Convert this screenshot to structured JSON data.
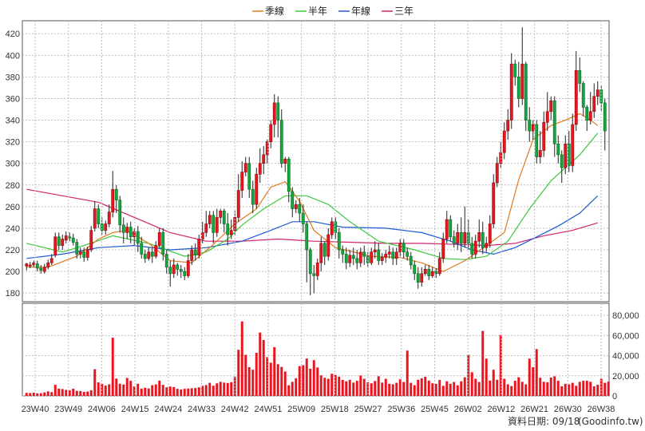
{
  "chart_data": {
    "type": "candlestick",
    "legend": [
      {
        "label": "季線",
        "color": "#e07a1c"
      },
      {
        "label": "半年",
        "color": "#3cc83c"
      },
      {
        "label": "年線",
        "color": "#1e5ad2"
      },
      {
        "label": "三年",
        "color": "#d2236e"
      }
    ],
    "x_ticks": [
      "23W40",
      "23W49",
      "24W06",
      "24W15",
      "24W24",
      "24W33",
      "24W42",
      "24W51",
      "25W09",
      "25W18",
      "25W27",
      "25W36",
      "25W45",
      "26W02",
      "26W12",
      "26W21",
      "26W30",
      "26W38"
    ],
    "price_ticks": [
      "180",
      "200",
      "220",
      "240",
      "260",
      "280",
      "300",
      "320",
      "340",
      "360",
      "380",
      "400",
      "420"
    ],
    "price_range": [
      172,
      432
    ],
    "volume_ticks": [
      "0",
      "20,000",
      "40,000",
      "60,000",
      "80,000"
    ],
    "volume_range": [
      0,
      92000
    ],
    "candles": [
      [
        205,
        207,
        201,
        208
      ],
      [
        205,
        206,
        203,
        209
      ],
      [
        206,
        208,
        204,
        210
      ],
      [
        207,
        203,
        200,
        210
      ],
      [
        203,
        201,
        198,
        206
      ],
      [
        200,
        204,
        198,
        207
      ],
      [
        204,
        208,
        202,
        211
      ],
      [
        208,
        212,
        206,
        216
      ],
      [
        215,
        232,
        213,
        236
      ],
      [
        232,
        224,
        220,
        236
      ],
      [
        224,
        230,
        220,
        234
      ],
      [
        229,
        233,
        226,
        237
      ],
      [
        232,
        231,
        228,
        236
      ],
      [
        231,
        227,
        224,
        235
      ],
      [
        227,
        216,
        212,
        230
      ],
      [
        216,
        218,
        212,
        222
      ],
      [
        218,
        213,
        209,
        222
      ],
      [
        213,
        220,
        210,
        223
      ],
      [
        220,
        238,
        218,
        242
      ],
      [
        240,
        258,
        237,
        265
      ],
      [
        258,
        244,
        240,
        262
      ],
      [
        244,
        238,
        234,
        250
      ],
      [
        238,
        244,
        234,
        247
      ],
      [
        244,
        255,
        241,
        262
      ],
      [
        255,
        276,
        250,
        293
      ],
      [
        276,
        266,
        254,
        280
      ],
      [
        266,
        243,
        236,
        270
      ],
      [
        243,
        236,
        226,
        250
      ],
      [
        236,
        241,
        230,
        245
      ],
      [
        241,
        232,
        226,
        246
      ],
      [
        232,
        237,
        224,
        240
      ],
      [
        237,
        226,
        218,
        242
      ],
      [
        226,
        216,
        212,
        232
      ],
      [
        216,
        212,
        208,
        220
      ],
      [
        212,
        218,
        210,
        222
      ],
      [
        218,
        214,
        208,
        222
      ],
      [
        214,
        224,
        212,
        228
      ],
      [
        224,
        236,
        222,
        240
      ],
      [
        236,
        216,
        210,
        240
      ],
      [
        216,
        204,
        198,
        220
      ],
      [
        204,
        198,
        186,
        210
      ],
      [
        198,
        206,
        194,
        212
      ],
      [
        206,
        202,
        196,
        208
      ],
      [
        202,
        200,
        194,
        206
      ],
      [
        200,
        196,
        192,
        204
      ],
      [
        196,
        210,
        194,
        216
      ],
      [
        210,
        220,
        206,
        224
      ],
      [
        220,
        215,
        210,
        226
      ],
      [
        215,
        230,
        212,
        234
      ],
      [
        230,
        236,
        226,
        246
      ],
      [
        236,
        244,
        232,
        256
      ],
      [
        244,
        252,
        240,
        256
      ],
      [
        252,
        236,
        226,
        256
      ],
      [
        236,
        250,
        232,
        258
      ],
      [
        250,
        256,
        244,
        258
      ],
      [
        256,
        244,
        236,
        258
      ],
      [
        244,
        234,
        224,
        254
      ],
      [
        234,
        238,
        230,
        248
      ],
      [
        238,
        250,
        234,
        256
      ],
      [
        250,
        275,
        246,
        290
      ],
      [
        275,
        292,
        268,
        302
      ],
      [
        292,
        300,
        288,
        306
      ],
      [
        300,
        276,
        268,
        306
      ],
      [
        276,
        262,
        254,
        284
      ],
      [
        262,
        290,
        258,
        296
      ],
      [
        290,
        300,
        282,
        314
      ],
      [
        300,
        308,
        290,
        316
      ],
      [
        308,
        320,
        300,
        322
      ],
      [
        320,
        336,
        314,
        340
      ],
      [
        336,
        356,
        324,
        364
      ],
      [
        356,
        340,
        324,
        362
      ],
      [
        340,
        300,
        296,
        350
      ],
      [
        300,
        304,
        292,
        306
      ],
      [
        304,
        274,
        264,
        306
      ],
      [
        274,
        258,
        250,
        278
      ],
      [
        258,
        262,
        254,
        266
      ],
      [
        262,
        254,
        246,
        268
      ],
      [
        254,
        244,
        236,
        262
      ],
      [
        244,
        220,
        190,
        246
      ],
      [
        220,
        198,
        178,
        222
      ],
      [
        198,
        196,
        180,
        206
      ],
      [
        196,
        208,
        192,
        212
      ],
      [
        208,
        226,
        200,
        232
      ],
      [
        226,
        214,
        206,
        228
      ],
      [
        214,
        234,
        210,
        240
      ],
      [
        234,
        246,
        230,
        250
      ],
      [
        246,
        236,
        230,
        250
      ],
      [
        236,
        220,
        212,
        240
      ],
      [
        220,
        216,
        208,
        224
      ],
      [
        216,
        208,
        202,
        222
      ],
      [
        208,
        215,
        204,
        220
      ],
      [
        215,
        212,
        206,
        222
      ],
      [
        212,
        208,
        202,
        220
      ],
      [
        208,
        218,
        204,
        222
      ],
      [
        218,
        214,
        206,
        224
      ],
      [
        214,
        208,
        204,
        218
      ],
      [
        208,
        218,
        206,
        222
      ],
      [
        218,
        220,
        212,
        228
      ],
      [
        220,
        210,
        206,
        226
      ],
      [
        210,
        213,
        206,
        217
      ],
      [
        213,
        216,
        208,
        220
      ],
      [
        216,
        218,
        212,
        224
      ],
      [
        218,
        212,
        206,
        222
      ],
      [
        212,
        218,
        206,
        222
      ],
      [
        218,
        226,
        214,
        230
      ],
      [
        226,
        218,
        212,
        230
      ],
      [
        218,
        214,
        210,
        222
      ],
      [
        214,
        206,
        202,
        218
      ],
      [
        206,
        198,
        192,
        210
      ],
      [
        198,
        190,
        184,
        204
      ],
      [
        190,
        198,
        186,
        204
      ],
      [
        198,
        202,
        196,
        206
      ],
      [
        202,
        196,
        192,
        206
      ],
      [
        196,
        200,
        194,
        204
      ],
      [
        200,
        198,
        194,
        203
      ],
      [
        198,
        212,
        196,
        218
      ],
      [
        212,
        230,
        208,
        236
      ],
      [
        230,
        248,
        226,
        256
      ],
      [
        248,
        232,
        228,
        252
      ],
      [
        232,
        226,
        222,
        238
      ],
      [
        226,
        236,
        220,
        244
      ],
      [
        236,
        226,
        218,
        250
      ],
      [
        226,
        236,
        222,
        260
      ],
      [
        236,
        226,
        220,
        248
      ],
      [
        226,
        216,
        212,
        232
      ],
      [
        216,
        228,
        212,
        234
      ],
      [
        228,
        236,
        222,
        248
      ],
      [
        236,
        222,
        216,
        246
      ],
      [
        222,
        226,
        218,
        232
      ],
      [
        226,
        244,
        222,
        252
      ],
      [
        244,
        282,
        240,
        290
      ],
      [
        282,
        300,
        278,
        306
      ],
      [
        300,
        310,
        296,
        320
      ],
      [
        310,
        330,
        304,
        338
      ],
      [
        330,
        340,
        322,
        350
      ],
      [
        340,
        392,
        332,
        402
      ],
      [
        392,
        380,
        372,
        396
      ],
      [
        380,
        360,
        352,
        394
      ],
      [
        360,
        392,
        354,
        426
      ],
      [
        392,
        340,
        330,
        394
      ],
      [
        340,
        330,
        320,
        352
      ],
      [
        330,
        336,
        322,
        340
      ],
      [
        336,
        306,
        300,
        340
      ],
      [
        306,
        312,
        300,
        330
      ],
      [
        312,
        338,
        306,
        348
      ],
      [
        338,
        348,
        330,
        366
      ],
      [
        348,
        358,
        340,
        362
      ],
      [
        358,
        318,
        306,
        362
      ],
      [
        318,
        308,
        300,
        326
      ],
      [
        308,
        296,
        282,
        312
      ],
      [
        296,
        318,
        290,
        326
      ],
      [
        318,
        298,
        292,
        330
      ],
      [
        298,
        336,
        292,
        346
      ],
      [
        336,
        386,
        330,
        404
      ],
      [
        386,
        374,
        366,
        398
      ],
      [
        374,
        352,
        344,
        376
      ],
      [
        352,
        340,
        330,
        354
      ],
      [
        340,
        348,
        336,
        366
      ],
      [
        348,
        362,
        342,
        374
      ],
      [
        362,
        368,
        354,
        376
      ],
      [
        368,
        356,
        348,
        372
      ],
      [
        356,
        330,
        312,
        360
      ]
    ],
    "volumes": [
      3000,
      2800,
      3200,
      2500,
      2600,
      3500,
      4500,
      3800,
      11000,
      7200,
      6800,
      6000,
      5500,
      7100,
      5000,
      4800,
      3900,
      4300,
      5600,
      26500,
      13400,
      12000,
      10200,
      11500,
      57800,
      17200,
      12100,
      11300,
      17800,
      15000,
      9500,
      12000,
      7200,
      8100,
      7400,
      10600,
      11400,
      15200,
      11000,
      8500,
      9300,
      8800,
      7000,
      6400,
      7000,
      7300,
      7600,
      7900,
      8500,
      10000,
      10800,
      13000,
      10100,
      12500,
      14000,
      13200,
      12800,
      13600,
      19200,
      45800,
      74000,
      40800,
      28500,
      26000,
      42800,
      62900,
      55500,
      38500,
      33000,
      48400,
      31500,
      28800,
      24200,
      10500,
      14000,
      17500,
      29600,
      30500,
      37100,
      27000,
      35500,
      28200,
      20400,
      18000,
      17000,
      22000,
      20700,
      19100,
      15900,
      14500,
      16000,
      13200,
      15000,
      20200,
      17000,
      13500,
      12500,
      14800,
      19500,
      13200,
      17000,
      12000,
      11500,
      13000,
      16500,
      13800,
      45000,
      13000,
      10600,
      16000,
      17500,
      19000,
      15200,
      12500,
      12000,
      15800,
      10000,
      14500,
      12000,
      13800,
      10500,
      14500,
      18500,
      40800,
      23500,
      17000,
      13800,
      64500,
      37000,
      15200,
      26000,
      16000,
      60500,
      17000,
      11500,
      9800,
      15000,
      18500,
      14000,
      11500,
      37000,
      28500,
      46500,
      18000,
      14000,
      13500,
      18200,
      19500,
      15000,
      9500,
      12000,
      11500,
      13000,
      10000,
      14000,
      15000,
      15000,
      14000,
      9500,
      11000,
      17000,
      13000,
      14200
    ],
    "ma_quarter": [
      [
        0,
        204
      ],
      [
        6,
        204
      ],
      [
        14,
        214
      ],
      [
        20,
        230
      ],
      [
        24,
        236
      ],
      [
        28,
        238
      ],
      [
        34,
        226
      ],
      [
        40,
        210
      ],
      [
        46,
        208
      ],
      [
        52,
        225
      ],
      [
        58,
        244
      ],
      [
        64,
        258
      ],
      [
        68,
        278
      ],
      [
        72,
        283
      ],
      [
        76,
        265
      ],
      [
        80,
        238
      ],
      [
        86,
        222
      ],
      [
        96,
        214
      ],
      [
        104,
        213
      ],
      [
        110,
        208
      ],
      [
        116,
        200
      ],
      [
        122,
        210
      ],
      [
        128,
        224
      ],
      [
        133,
        236
      ],
      [
        137,
        285
      ],
      [
        141,
        322
      ],
      [
        146,
        335
      ],
      [
        150,
        340
      ],
      [
        154,
        346
      ],
      [
        157,
        340
      ],
      [
        159,
        335
      ]
    ],
    "ma_half": [
      [
        0,
        226
      ],
      [
        10,
        218
      ],
      [
        16,
        224
      ],
      [
        24,
        233
      ],
      [
        34,
        226
      ],
      [
        44,
        214
      ],
      [
        50,
        218
      ],
      [
        56,
        230
      ],
      [
        60,
        243
      ],
      [
        66,
        258
      ],
      [
        72,
        270
      ],
      [
        78,
        270
      ],
      [
        84,
        262
      ],
      [
        90,
        246
      ],
      [
        98,
        228
      ],
      [
        108,
        220
      ],
      [
        116,
        212
      ],
      [
        122,
        211
      ],
      [
        128,
        214
      ],
      [
        134,
        228
      ],
      [
        140,
        258
      ],
      [
        146,
        284
      ],
      [
        150,
        296
      ],
      [
        154,
        308
      ],
      [
        159,
        328
      ]
    ],
    "ma_year": [
      [
        0,
        212
      ],
      [
        10,
        216
      ],
      [
        20,
        222
      ],
      [
        30,
        224
      ],
      [
        40,
        220
      ],
      [
        50,
        222
      ],
      [
        60,
        228
      ],
      [
        68,
        238
      ],
      [
        74,
        246
      ],
      [
        80,
        246
      ],
      [
        88,
        241
      ],
      [
        100,
        240
      ],
      [
        110,
        236
      ],
      [
        118,
        228
      ],
      [
        124,
        220
      ],
      [
        130,
        216
      ],
      [
        136,
        222
      ],
      [
        142,
        232
      ],
      [
        148,
        242
      ],
      [
        154,
        254
      ],
      [
        159,
        270
      ]
    ],
    "ma_3year": [
      [
        0,
        276
      ],
      [
        10,
        270
      ],
      [
        20,
        264
      ],
      [
        30,
        250
      ],
      [
        40,
        236
      ],
      [
        50,
        228
      ],
      [
        60,
        228
      ],
      [
        70,
        230
      ],
      [
        80,
        228
      ],
      [
        90,
        227
      ],
      [
        100,
        226
      ],
      [
        110,
        226
      ],
      [
        120,
        225
      ],
      [
        128,
        224
      ],
      [
        136,
        226
      ],
      [
        144,
        233
      ],
      [
        152,
        238
      ],
      [
        159,
        245
      ]
    ],
    "footer_label": "資料日期: 09/18",
    "source": "(Goodinfo.tw)"
  }
}
